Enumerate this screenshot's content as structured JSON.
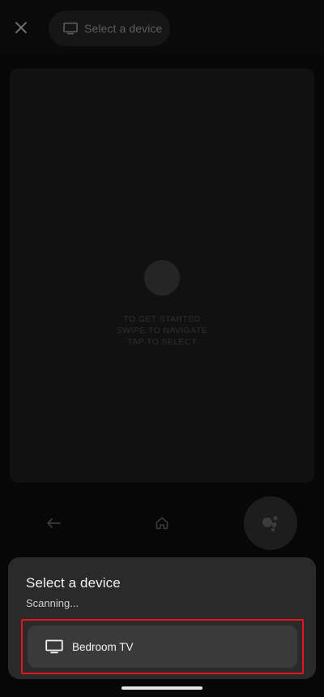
{
  "topbar": {
    "close_icon": "close-icon",
    "device_selector": {
      "icon": "tv-icon",
      "label": "Select a device"
    }
  },
  "touchpad": {
    "hint_lines": [
      "TO GET STARTED",
      "SWIPE TO NAVIGATE",
      "TAP TO SELECT"
    ]
  },
  "controls": {
    "back_icon": "back-arrow-icon",
    "home_icon": "home-icon",
    "assistant_icon": "google-assistant-icon"
  },
  "sheet": {
    "title": "Select a device",
    "status": "Scanning...",
    "devices": [
      {
        "icon": "tv-icon",
        "name": "Bedroom TV"
      }
    ],
    "highlight_color": "#e5141f"
  },
  "colors": {
    "background": "#070707",
    "sheet": "#2a2a2a",
    "device_row": "#3a3a3a"
  }
}
